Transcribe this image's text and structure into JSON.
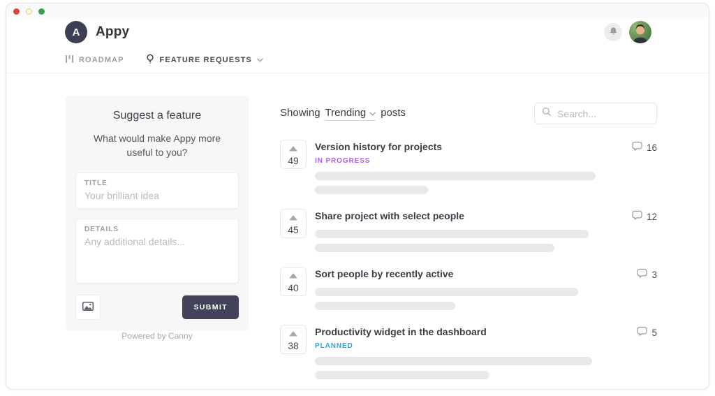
{
  "window": {
    "traffic_lights": {
      "close": "#e0443e",
      "minimize": "#fdf7e0",
      "maximize": "#38a152"
    }
  },
  "header": {
    "logo_letter": "A",
    "app_name": "Appy",
    "nav_roadmap": "ROADMAP",
    "nav_feature_requests": "FEATURE REQUESTS",
    "icons": {
      "roadmap": "bar-chart-icon",
      "feature_requests": "lightbulb-icon",
      "dropdown": "chevron-down-icon",
      "notifications": "bell-icon",
      "avatar": "user-photo"
    }
  },
  "sidebar": {
    "title": "Suggest a feature",
    "subtitle": "What would make Appy more useful to you?",
    "title_field": {
      "label": "TITLE",
      "placeholder": "Your brilliant idea",
      "value": ""
    },
    "details_field": {
      "label": "DETAILS",
      "placeholder": "Any additional details...",
      "value": ""
    },
    "attach_icon": "image-icon",
    "submit_label": "SUBMIT",
    "powered_by": "Powered by Canny"
  },
  "main": {
    "showing_prefix": "Showing",
    "sort_selected": "Trending",
    "showing_suffix": "posts",
    "search": {
      "placeholder": "Search...",
      "icon": "search-icon"
    },
    "posts": [
      {
        "votes": "49",
        "title": "Version history for projects",
        "status": {
          "label": "IN PROGRESS",
          "color": "#b15ee3"
        },
        "comments": "16",
        "bars": [
          "82%",
          "33%"
        ]
      },
      {
        "votes": "45",
        "title": "Share project with select people",
        "comments": "12",
        "bars": [
          "80%",
          "70%"
        ]
      },
      {
        "votes": "40",
        "title": "Sort people by recently active",
        "comments": "3",
        "bars": [
          "77%",
          "41%"
        ]
      },
      {
        "votes": "38",
        "title": "Productivity widget in the dashboard",
        "status": {
          "label": "PLANNED",
          "color": "#1fa7ea"
        },
        "comments": "5",
        "bars": [
          "81%",
          "51%"
        ]
      }
    ]
  }
}
